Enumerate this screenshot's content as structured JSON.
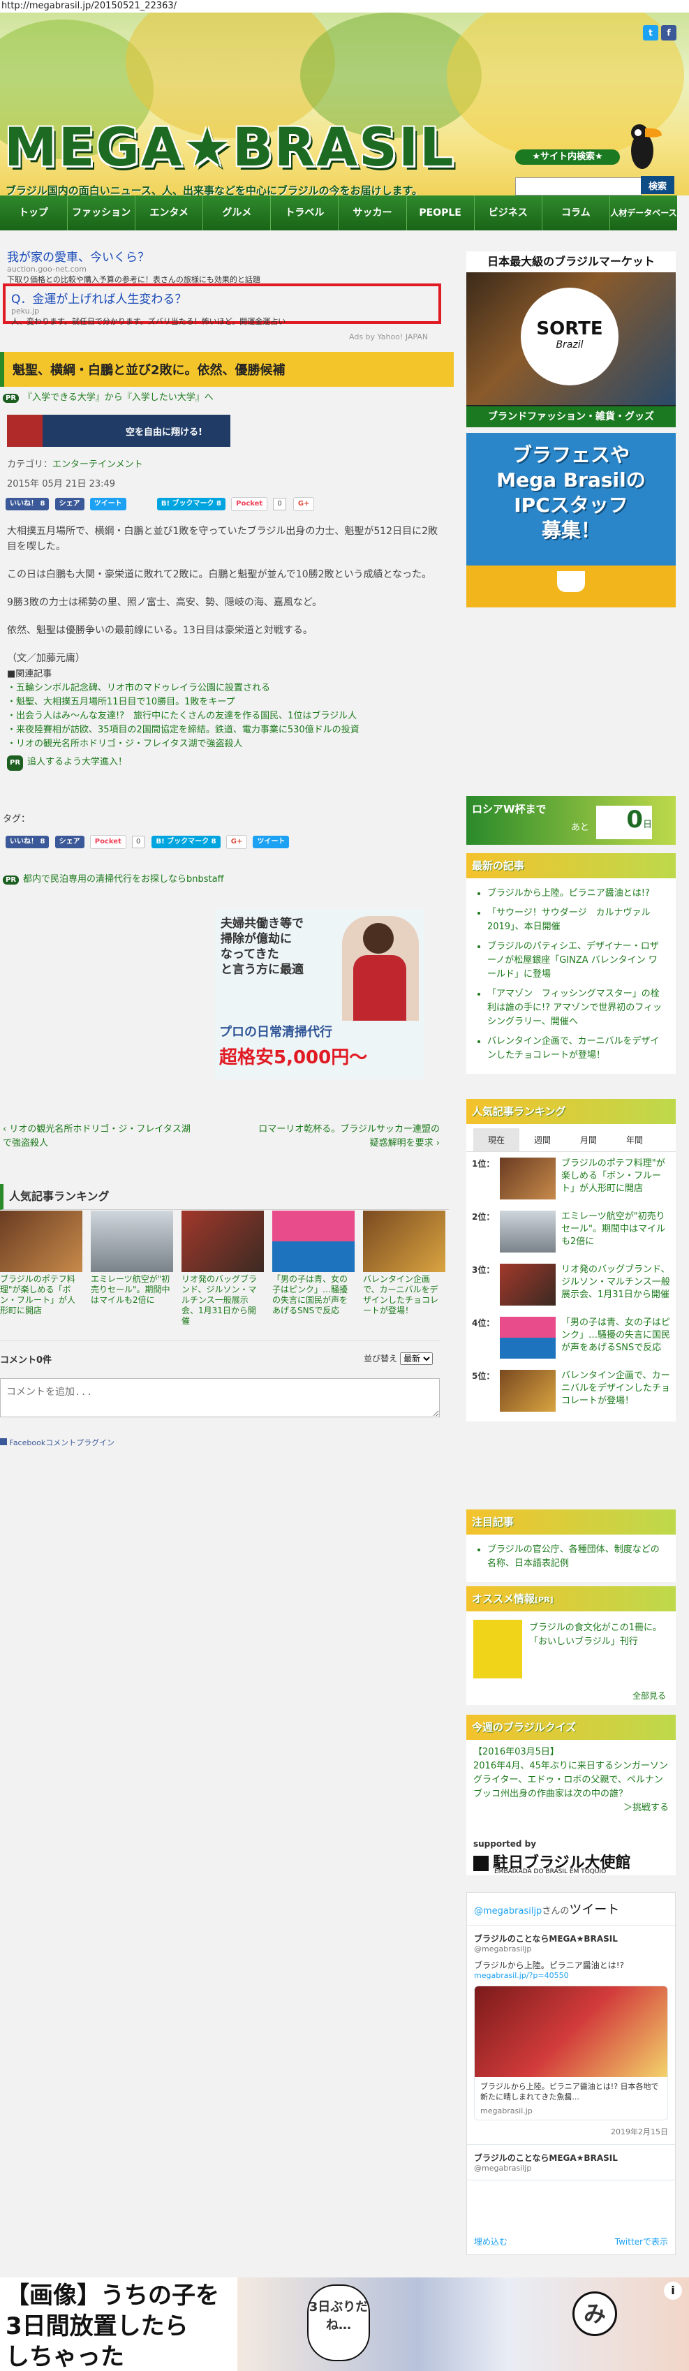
{
  "url": "http://megabrasil.jp/20150521_22363/",
  "header": {
    "logo": "MEGA★BRASIL",
    "tagline": "ブラジル国内の面白いニュース、人、出来事などを中心にブラジルの今をお届けします。",
    "search_label": "★サイト内検索★",
    "search_button": "検索",
    "colors": {
      "nav": "#1e6c1c",
      "accent": "#f3c52b",
      "link": "#1d7a1d"
    }
  },
  "nav": [
    {
      "label": "トップ"
    },
    {
      "label": "ファッション"
    },
    {
      "label": "エンタメ"
    },
    {
      "label": "グルメ"
    },
    {
      "label": "トラベル"
    },
    {
      "label": "サッカー"
    },
    {
      "label": "PEOPLE"
    },
    {
      "label": "ビジネス"
    },
    {
      "label": "コラム"
    },
    {
      "label": "人材データベース"
    }
  ],
  "ads": {
    "ad1": {
      "title": "我が家の愛車、今いくら？",
      "domain": "auction.goo-net.com",
      "desc": "下取り価格との比較や購入予算の参考に！表さんの旅様にも効果的と話題"
    },
    "ad2": {
      "title": "Q．金運が上げれば人生変わる？",
      "domain": "peku.jp",
      "desc": "人、変わります。就任日で分かります。ズバリ当たる！怖いほど。開運金運占い"
    },
    "credit": "Ads by Yahoo! JAPAN"
  },
  "article": {
    "title": "魁聖、横綱・白鵬と並び2敗に。依然、優勝候補",
    "pr_link": "『入学できる大学』から『入学したい大学』へ",
    "pr_label": "PR",
    "category_label": "カテゴリ：",
    "category": "エンターテインメント",
    "date": "2015年 05月 21日 23:49",
    "share": {
      "like": "いいね！ 8",
      "share": "シェア",
      "tweet": "ツイート",
      "bookmark": "B! ブックマーク",
      "bookmark_count": "8",
      "pocket": "Pocket",
      "pocket_count": "0",
      "gplus": "G+"
    },
    "paragraphs": [
      "大相撲五月場所で、横綱・白鵬と並び1敗を守っていたブラジル出身の力士、魁聖が512日目に2敗目を喫した。",
      "この日は白鵬も大関・豪栄道に敗れて2敗に。白鵬と魁聖が並んで10勝2敗という成績となった。",
      "9勝3敗の力士は稀勢の里、照ノ富士、高安、勢、隠岐の海、嘉風など。",
      "依然、魁聖は優勝争いの最前線にいる。13日目は豪栄道と対戦する。",
      "（文／加藤元庸）"
    ],
    "related_title": "■関連記事",
    "related": [
      "・五輪シンボル記念碑、リオ市のマドゥレイラ公園に設置される",
      "・魁聖、大相撲五月場所11日目で10勝目。1敗をキープ",
      "・出会う人はみ～んな友達!?　旅行中にたくさんの友達を作る国民、1位はブラジル人",
      "・来夜陸賽相が訪欧、35項目の2国間協定を締結。鉄道、電力事業に530億ドルの投資",
      "・リオの観光名所ホドリゴ・ジ・フレイタス湖で強盗殺人"
    ],
    "pr2": "追人するよう大学進入！",
    "tags_label": "タグ：",
    "pr3": "都内で民泊専用の清掃代行をお探しならbnbstaff",
    "cleaning_ad": {
      "line1": "夫婦共働き等で",
      "line2": "掃除が億劫に",
      "line3": "なってきた",
      "line4": "と言う方に最適",
      "line5": "プロの日常清掃代行",
      "price": "超格安5,000円〜"
    },
    "prev": "リオの観光名所ホドリゴ・ジ・フレイタス湖で強盗殺人",
    "next": "ロマーリオ乾杯る。ブラジルサッカー連盟の疑惑解明を要求"
  },
  "popular": {
    "title": "人気記事ランキング",
    "items": [
      {
        "caption": "ブラジルのポテフ料理\"が楽しめる「ボン・フルート」が人形町に開店"
      },
      {
        "caption": "エミレーツ航空が\"初売りセール\"。期間中はマイルも2倍に"
      },
      {
        "caption": "リオ発のバッグブランド、ジルソン・マルチンス一般展示会、1月31日から開催"
      },
      {
        "caption": "「男の子は青、女の子はピンク」…騒擾の失言に国民が声をあげるSNSで反応"
      },
      {
        "caption": "バレンタイン企画で、カーニバルをデザインしたチョコレートが登場！"
      }
    ]
  },
  "comments": {
    "count": "コメント0件",
    "sort_label": "並び替え",
    "sort_value": "最新",
    "placeholder": "コメントを追加...",
    "plugin": "Facebookコメントプラグイン"
  },
  "sidebar": {
    "ad_top": {
      "title": "日本最大級のブラジルマーケット",
      "brand": "SORTE",
      "sub": "Brazil",
      "footer": "ブランドファッション・雑貨・グッズ"
    },
    "ad_recruit": {
      "line1": "ブラフェスや",
      "line2": "Mega Brasilの",
      "line3": "IPCスタッフ",
      "line4": "募集！"
    },
    "countdown": {
      "label": "ロシアW杯まで",
      "sub": "あと",
      "days": "0",
      "unit": "日"
    },
    "latest": {
      "title": "最新の記事",
      "items": [
        "ブラジルから上陸。ピラニア醤油とは!?",
        "「サウージ！サウダージ　カルナヴァル2019」、本日開催",
        "ブラジルのパティシエ、デザイナー・ロザーノが松屋銀座「GINZA バレンタイン ワールド」に登場",
        "「アマゾン　フィッシングマスター」の栓利は誰の手に!? アマゾンで世界初のフィッシングラリー、開催へ",
        "バレンタイン企画で、カーニバルをデザインしたチョコレートが登場！"
      ]
    },
    "ranking": {
      "title": "人気記事ランキング",
      "tabs": [
        "現在",
        "週間",
        "月間",
        "年間"
      ],
      "items": [
        {
          "rank": "1位：",
          "text": "ブラジルのポテフ料理\"が楽しめる「ボン・フルート」が人形町に開店"
        },
        {
          "rank": "2位：",
          "text": "エミレーツ航空が\"初売りセール\"。期間中はマイルも2倍に"
        },
        {
          "rank": "3位：",
          "text": "リオ発のバッグブランド、ジルソン・マルチンス一般展示会、1月31日から開催"
        },
        {
          "rank": "4位：",
          "text": "「男の子は青、女の子はピンク」…騒擾の失言に国民が声をあげるSNSで反応"
        },
        {
          "rank": "5位：",
          "text": "バレンタイン企画で、カーニバルをデザインしたチョコレートが登場！"
        }
      ]
    },
    "notice": {
      "title": "注目記事",
      "items": [
        "ブラジルの官公庁、各種団体、制度などの名称、日本語表記例"
      ]
    },
    "recommend": {
      "title": "オススメ情報",
      "pr": "[PR]",
      "text": "ブラジルの食文化がこの1冊に。「おいしいブラジル」刊行",
      "more": "全部見る"
    },
    "quiz": {
      "title": "今週のブラジルクイズ",
      "date": "【2016年03月5日】",
      "text": "2016年4月、45年ぶりに来日するシンガーソングライター、エドゥ・ロボの父親で、ペルナンブッコ州出身の作曲家は次の中の誰？",
      "answer": "＞挑戦する",
      "supported": "supported by",
      "embassy": "駐日ブラジル大使館",
      "embassy_en": "EMBAIXADA DO BRASIL EM TÓQUIO"
    },
    "twitter": {
      "header_user": "@megabrasiljp",
      "header_suffix": "さんの",
      "header_label": "ツイート",
      "tweets": [
        {
          "name": "ブラジルのことならMEGA★BRASIL",
          "handle": "@megabrasiljp",
          "text": "ブラジルから上陸。ピラニア醤油とは!?",
          "link": "megabrasil.jp/?p=40550",
          "card_title": "ブラジルから上陸。ピラニア醤油とは!? 日本各地で新たに晴しまれてきた魚醤...",
          "card_domain": "megabrasil.jp",
          "date": "2019年2月15日"
        },
        {
          "name": "ブラジルのことならMEGA★BRASIL",
          "handle": "@megabrasiljp"
        }
      ],
      "embed": "埋め込む",
      "view": "Twitterで表示"
    }
  },
  "bottom_banner": {
    "text1": "【画像】うちの子を",
    "text2": "3日間放置したら",
    "text3": "しちゃった",
    "bubble": "3日ぶりだね…",
    "mi": "み"
  }
}
